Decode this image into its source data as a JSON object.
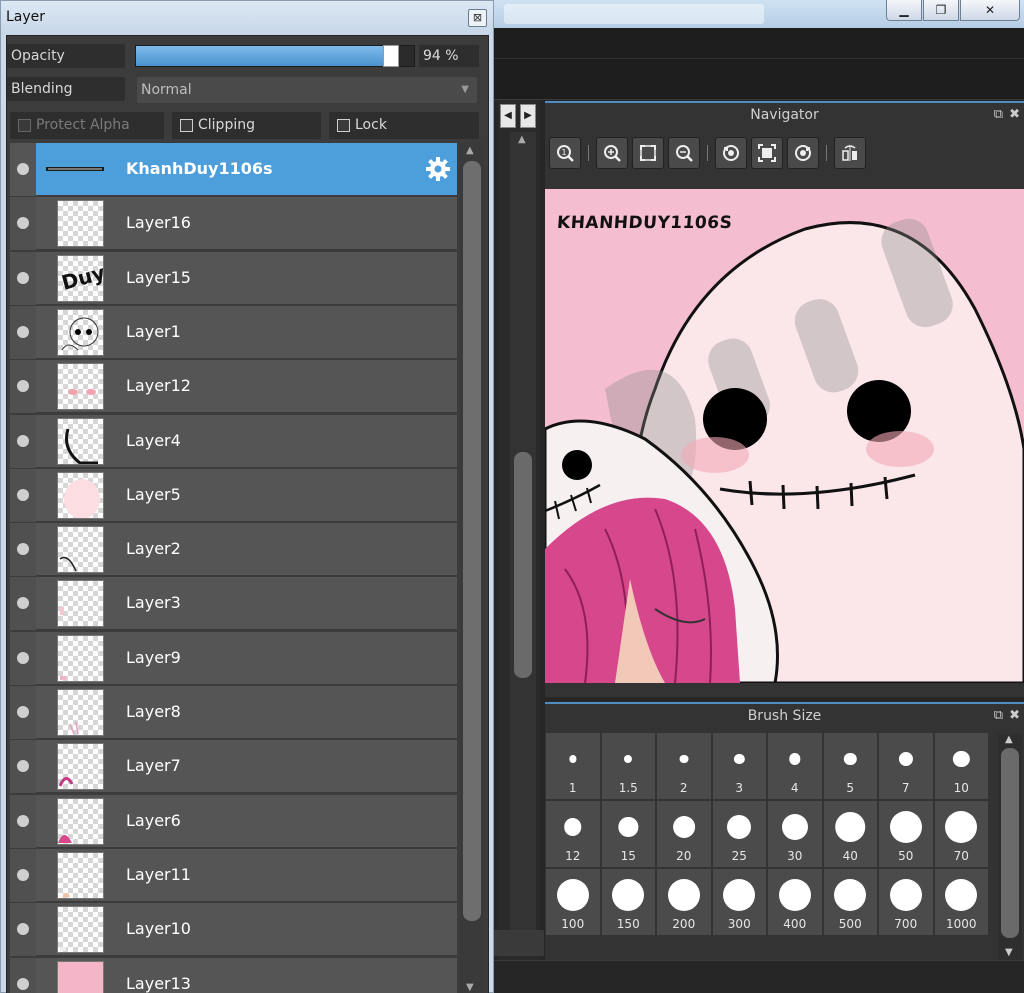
{
  "layer_window": {
    "title": "Layer",
    "close_glyph": "⊠",
    "opacity_label": "Opacity",
    "opacity_value": "94 %",
    "opacity_fraction": 0.94,
    "blending_label": "Blending",
    "blending_value": "Normal",
    "protect_alpha_label": "Protect Alpha",
    "clipping_label": "Clipping",
    "lock_label": "Lock",
    "layers": [
      {
        "name": "KhanhDuy1106s",
        "selected": true
      },
      {
        "name": "Layer16"
      },
      {
        "name": "Layer15"
      },
      {
        "name": "Layer1"
      },
      {
        "name": "Layer12"
      },
      {
        "name": "Layer4"
      },
      {
        "name": "Layer5"
      },
      {
        "name": "Layer2"
      },
      {
        "name": "Layer3"
      },
      {
        "name": "Layer9"
      },
      {
        "name": "Layer8"
      },
      {
        "name": "Layer7"
      },
      {
        "name": "Layer6"
      },
      {
        "name": "Layer11"
      },
      {
        "name": "Layer10"
      },
      {
        "name": "Layer13"
      }
    ]
  },
  "navigator": {
    "title": "Navigator",
    "canvas_signature": "KHANHDUY1106S",
    "tools": [
      "zoom-actual-icon",
      "zoom-in-icon",
      "fit-icon",
      "zoom-out-icon",
      "rotate-left-icon",
      "fullscreen-icon",
      "rotate-right-icon",
      "flip-icon"
    ]
  },
  "brush_size": {
    "title": "Brush Size",
    "sizes": [
      "1",
      "1.5",
      "2",
      "3",
      "4",
      "5",
      "7",
      "10",
      "12",
      "15",
      "20",
      "25",
      "30",
      "40",
      "50",
      "70",
      "100",
      "150",
      "200",
      "300",
      "400",
      "500",
      "700",
      "1000"
    ]
  },
  "window_controls": {
    "minimize": "▁",
    "restore": "❐",
    "close": "✕"
  },
  "colors": {
    "accent": "#4d9fdb",
    "canvas_bg": "#f5bdd0",
    "panel_bg": "#333333"
  }
}
